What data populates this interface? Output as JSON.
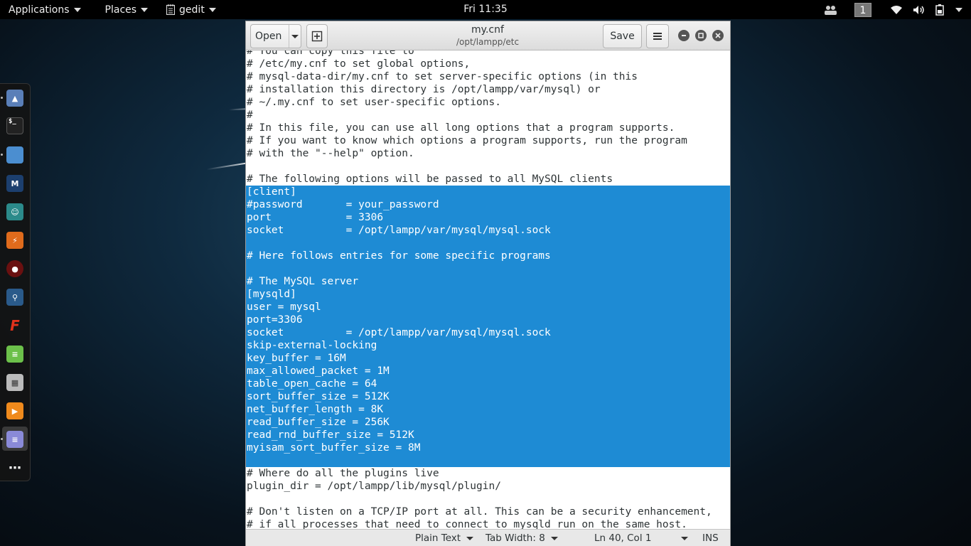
{
  "topbar": {
    "applications": "Applications",
    "places": "Places",
    "app_name": "gedit",
    "clock": "Fri 11:35",
    "workspace": "1"
  },
  "window": {
    "title": "my.cnf",
    "subtitle": "/opt/lampp/etc",
    "open_label": "Open",
    "save_label": "Save"
  },
  "editor": {
    "lines": [
      "# You can copy this file to",
      "# /etc/my.cnf to set global options,",
      "# mysql-data-dir/my.cnf to set server-specific options (in this",
      "# installation this directory is /opt/lampp/var/mysql) or",
      "# ~/.my.cnf to set user-specific options.",
      "#",
      "# In this file, you can use all long options that a program supports.",
      "# If you want to know which options a program supports, run the program",
      "# with the \"--help\" option.",
      "",
      "# The following options will be passed to all MySQL clients",
      "[client]",
      "#password       = your_password",
      "port            = 3306",
      "socket          = /opt/lampp/var/mysql/mysql.sock",
      "",
      "# Here follows entries for some specific programs",
      "",
      "# The MySQL server",
      "[mysqld]",
      "user = mysql",
      "port=3306",
      "socket          = /opt/lampp/var/mysql/mysql.sock",
      "skip-external-locking",
      "key_buffer = 16M",
      "max_allowed_packet = 1M",
      "table_open_cache = 64",
      "sort_buffer_size = 512K",
      "net_buffer_length = 8K",
      "read_buffer_size = 256K",
      "read_rnd_buffer_size = 512K",
      "myisam_sort_buffer_size = 8M",
      "",
      "# Where do all the plugins live",
      "plugin_dir = /opt/lampp/lib/mysql/plugin/",
      "",
      "# Don't listen on a TCP/IP port at all. This can be a security enhancement,",
      "# if all processes that need to connect to mysqld run on the same host."
    ],
    "selection_start": 11,
    "selection_end": 32
  },
  "statusbar": {
    "language": "Plain Text",
    "tab_width": "Tab Width: 8",
    "position": "Ln 40, Col 1",
    "mode": "INS"
  },
  "colors": {
    "selection": "#1e8bd4",
    "topbar": "#000000"
  }
}
